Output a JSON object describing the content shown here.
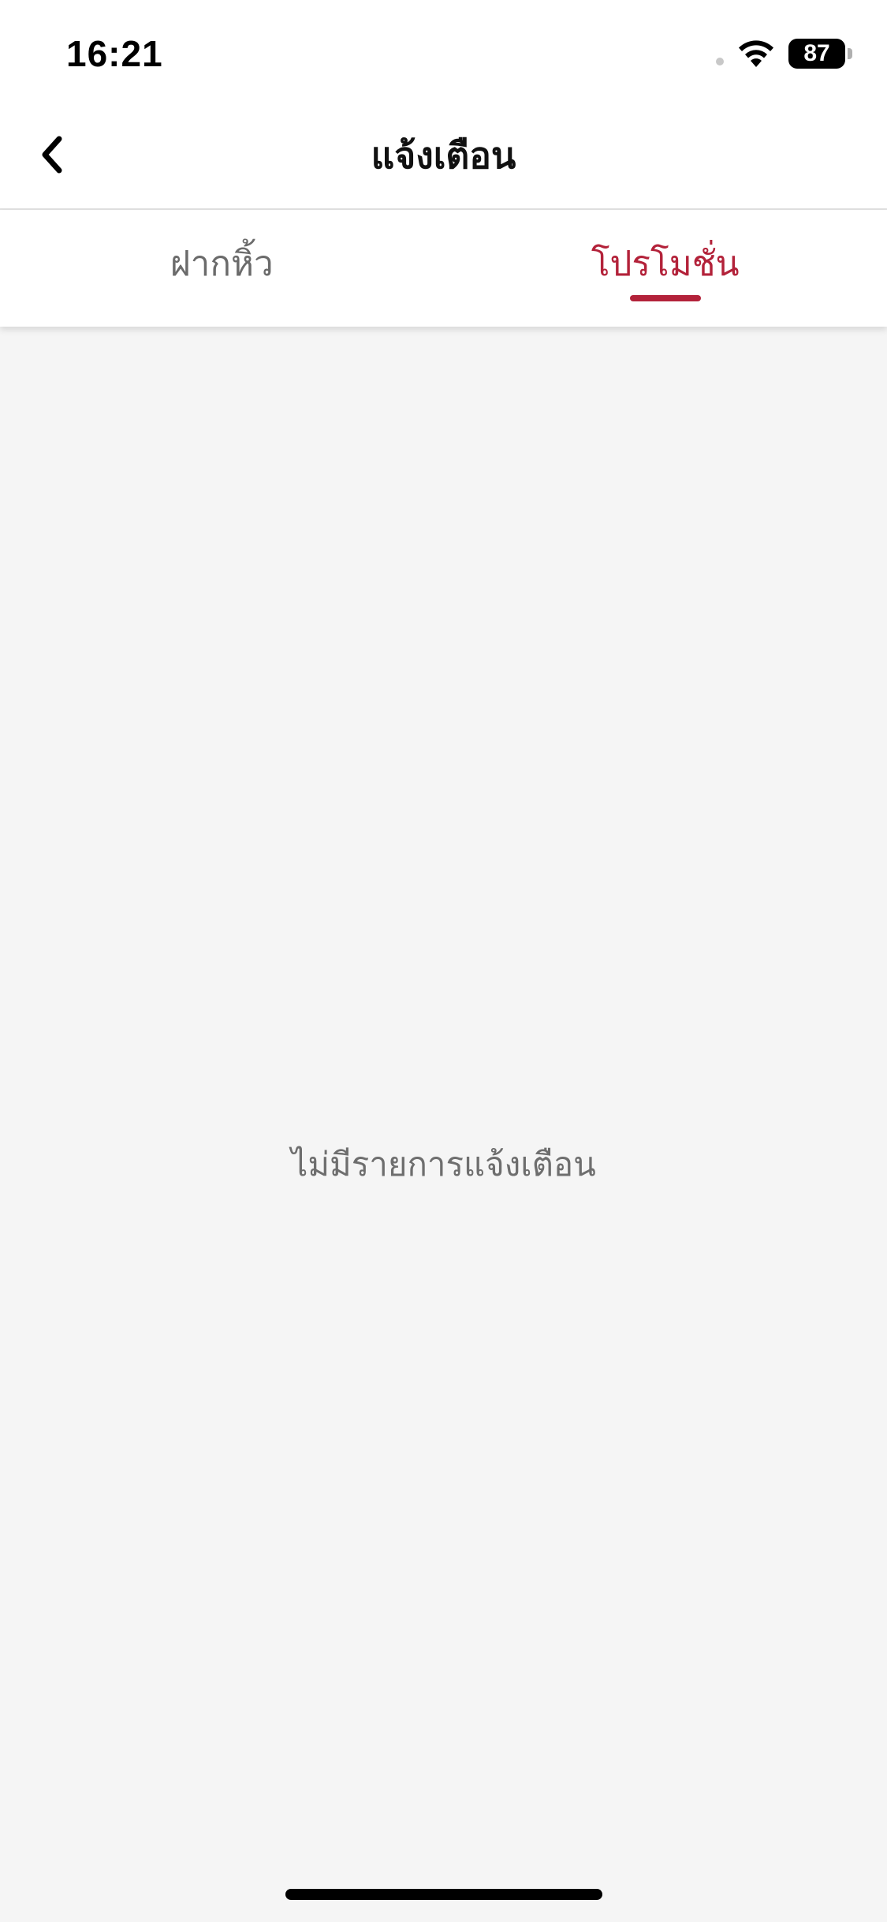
{
  "status_bar": {
    "time": "16:21",
    "battery": "87",
    "wifi_icon": "wifi-icon",
    "battery_icon": "battery-icon"
  },
  "nav": {
    "back_icon": "chevron-left-icon",
    "title": "แจ้งเตือน"
  },
  "tabs": [
    {
      "label": "ฝากหิ้ว",
      "active": false
    },
    {
      "label": "โปรโมชั่น",
      "active": true
    }
  ],
  "content": {
    "empty_message": "ไม่มีรายการแจ้งเตือน"
  },
  "colors": {
    "accent": "#b3223a",
    "inactive_tab": "#6b6b6b",
    "background": "#f5f5f5",
    "header_background": "#ffffff"
  }
}
